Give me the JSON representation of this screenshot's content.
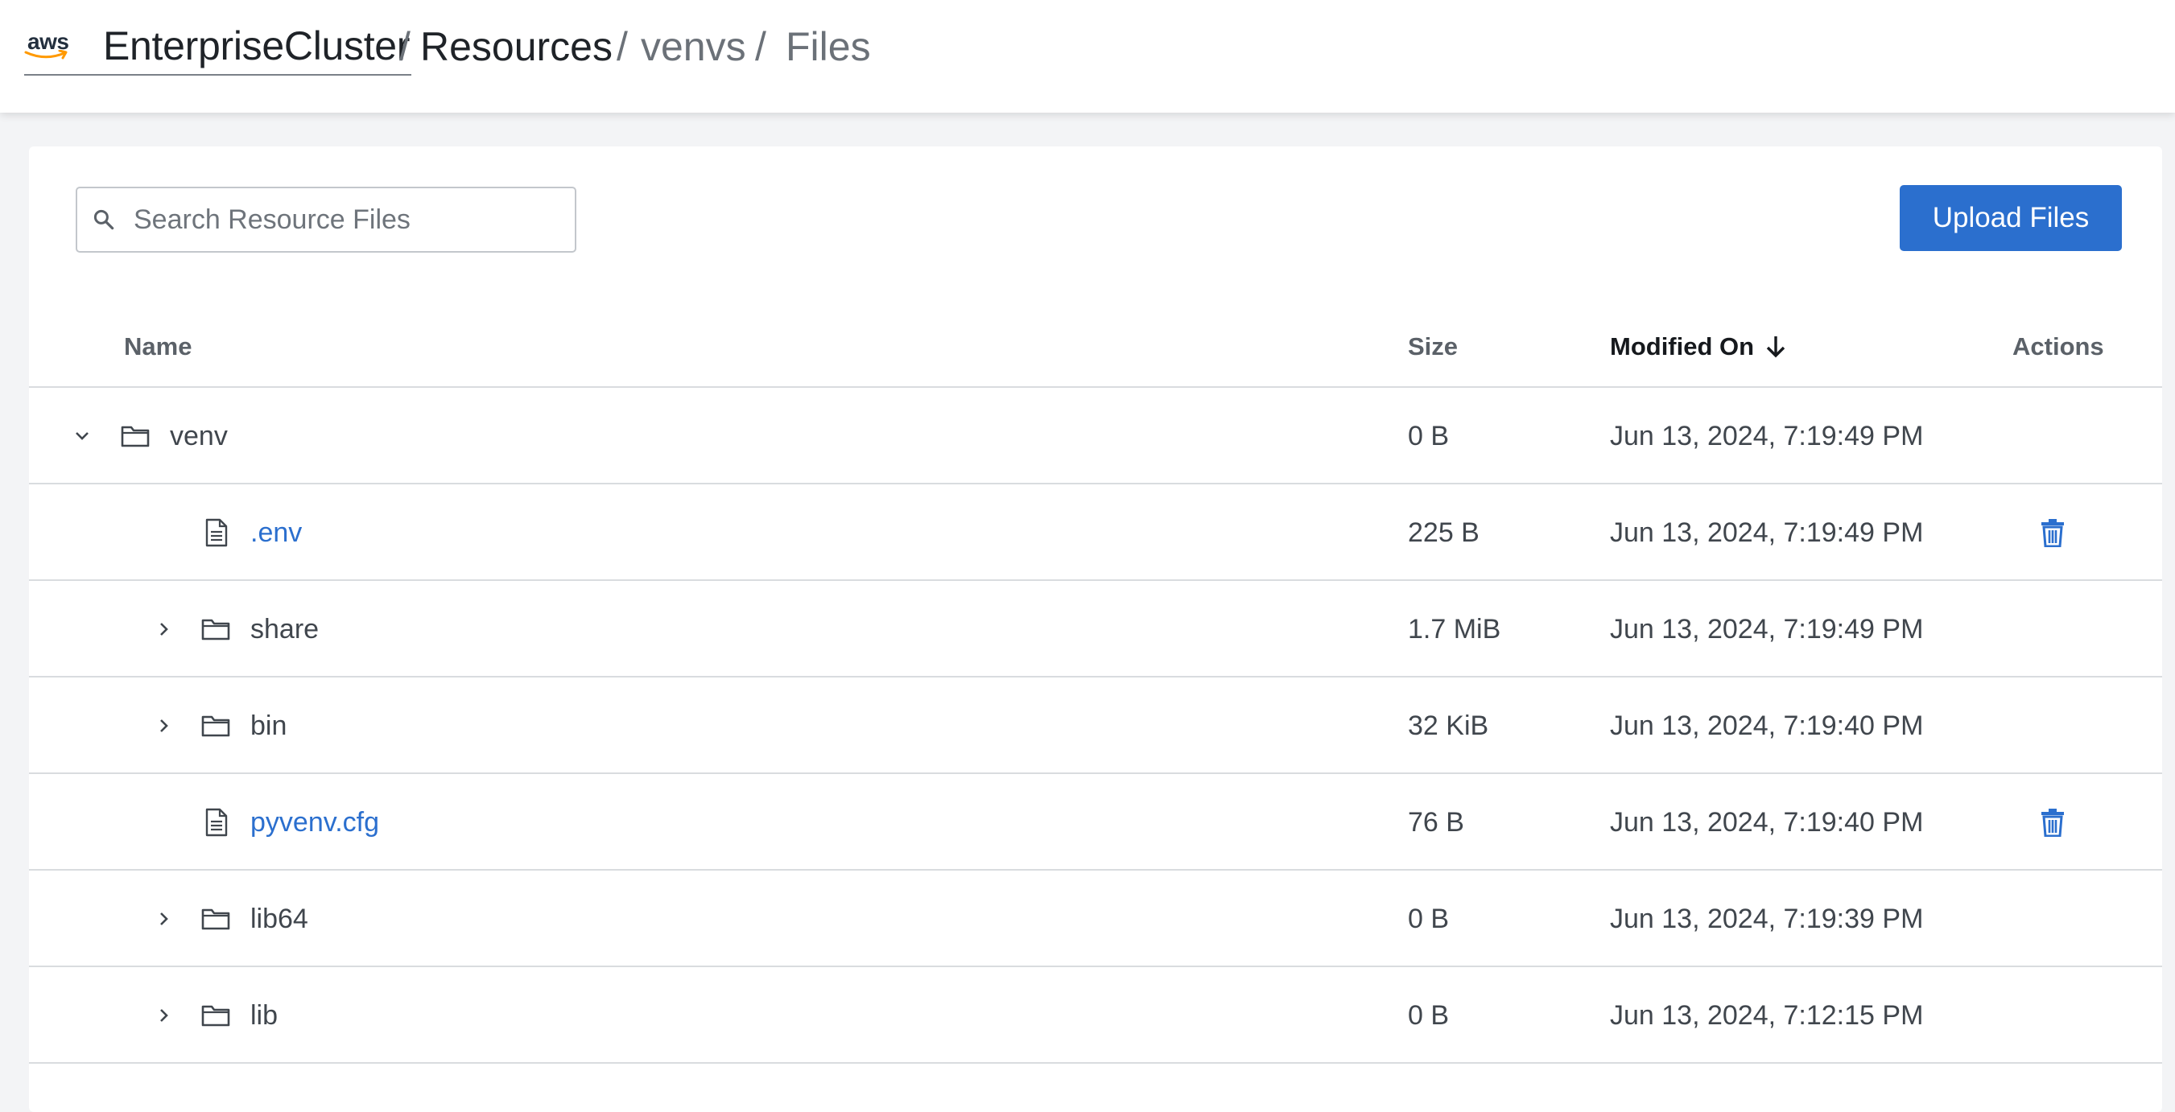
{
  "header": {
    "brand_logo_text": "aws",
    "breadcrumbs": [
      "EnterpriseCluster",
      "Resources",
      "venvs",
      "Files"
    ],
    "separator": "/"
  },
  "toolbar": {
    "search_placeholder": "Search Resource Files",
    "upload_label": "Upload Files"
  },
  "table": {
    "columns": {
      "name": "Name",
      "size": "Size",
      "modified": "Modified On",
      "actions": "Actions"
    },
    "sort": {
      "column": "Modified On",
      "direction": "descending"
    },
    "rows": [
      {
        "name": "venv",
        "type": "folder",
        "expanded": true,
        "level": 0,
        "size": "0 B",
        "modified": "Jun 13, 2024, 7:19:49 PM"
      },
      {
        "name": ".env",
        "type": "file",
        "level": 1,
        "size": "225 B",
        "modified": "Jun 13, 2024, 7:19:49 PM",
        "action": "delete-icon"
      },
      {
        "name": "share",
        "type": "folder",
        "expanded": false,
        "level": 1,
        "size": "1.7 MiB",
        "modified": "Jun 13, 2024, 7:19:49 PM"
      },
      {
        "name": "bin",
        "type": "folder",
        "expanded": false,
        "level": 1,
        "size": "32 KiB",
        "modified": "Jun 13, 2024, 7:19:40 PM"
      },
      {
        "name": "pyvenv.cfg",
        "type": "file",
        "level": 1,
        "size": "76 B",
        "modified": "Jun 13, 2024, 7:19:40 PM",
        "action": "delete-icon"
      },
      {
        "name": "lib64",
        "type": "folder",
        "expanded": false,
        "level": 1,
        "size": "0 B",
        "modified": "Jun 13, 2024, 7:19:39 PM"
      },
      {
        "name": "lib",
        "type": "folder",
        "expanded": false,
        "level": 1,
        "size": "0 B",
        "modified": "Jun 13, 2024, 7:12:15 PM"
      }
    ]
  },
  "colors": {
    "primary": "#2b6fce",
    "text": "#40464d",
    "header_bg": "#ffffff",
    "page_bg": "#f3f4f6"
  }
}
